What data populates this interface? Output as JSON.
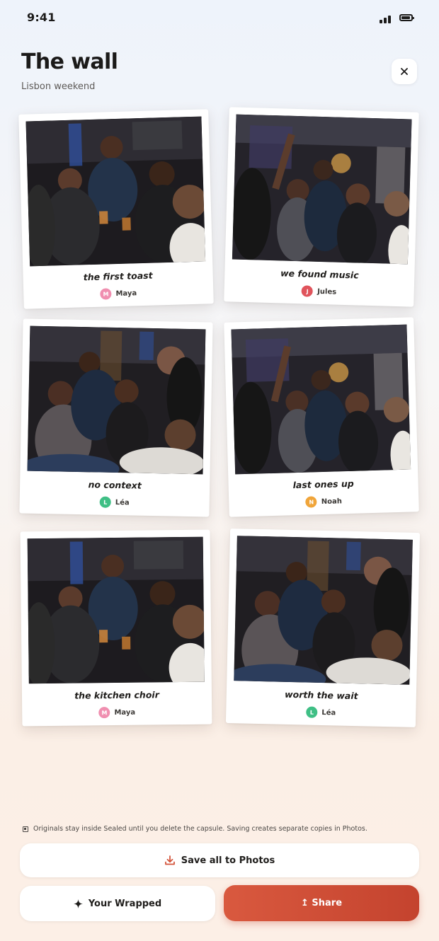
{
  "status_bar": {
    "time": "9:41"
  },
  "header": {
    "title": "The wall",
    "subtitle": "Lisbon weekend",
    "close_icon": "close-icon"
  },
  "cards": [
    {
      "caption": "the first toast",
      "author": "Maya",
      "initial": "M",
      "avatar_color": "#f08fb0",
      "photo": "group toast"
    },
    {
      "caption": "we found music",
      "author": "Jules",
      "initial": "J",
      "avatar_color": "#e0545c",
      "photo": "dancing"
    },
    {
      "caption": "no context",
      "author": "Léa",
      "initial": "L",
      "avatar_color": "#3fbf85",
      "photo": "laughing on floor"
    },
    {
      "caption": "last ones up",
      "author": "Noah",
      "initial": "N",
      "avatar_color": "#f0a53a",
      "photo": "dancing"
    },
    {
      "caption": "the kitchen choir",
      "author": "Maya",
      "initial": "M",
      "avatar_color": "#f08fb0",
      "photo": "group toast"
    },
    {
      "caption": "worth the wait",
      "author": "Léa",
      "initial": "L",
      "avatar_color": "#3fbf85",
      "photo": "laughing on floor"
    }
  ],
  "footer": {
    "notice": "Originals stay inside Sealed until you delete the capsule. Saving creates separate copies in Photos.",
    "save_all_label": "Save all to Photos",
    "wrapped_label": "Your Wrapped",
    "share_label": "↥ Share"
  },
  "colors": {
    "accent": "#d4553c",
    "background": "#f7f3ef"
  }
}
